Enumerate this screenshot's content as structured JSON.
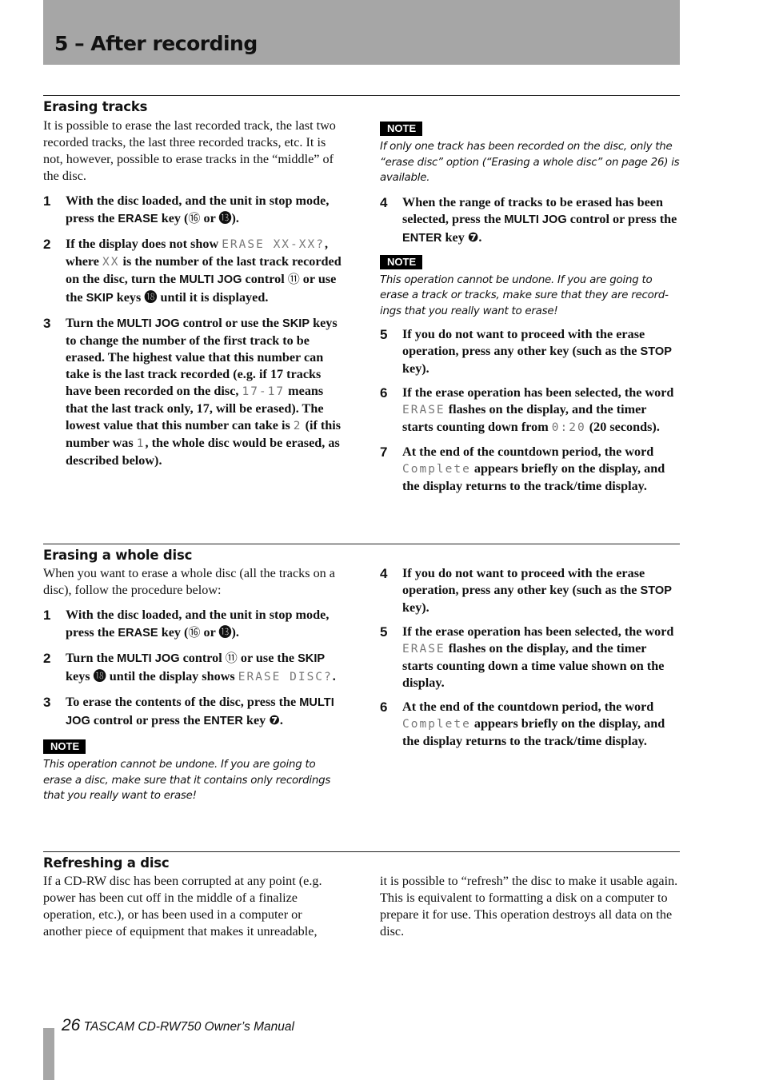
{
  "header": {
    "chapter_title": "5 – After recording"
  },
  "sections": {
    "erasing_tracks": {
      "title": "Erasing tracks",
      "intro": "It is possible to erase the last recorded track, the last two recorded tracks, the last three recorded tracks, etc. It is not, however, possible to erase tracks in the “middle” of the disc.",
      "steps_left": [
        {
          "num": "1",
          "segments": [
            {
              "t": "With the disc loaded, and the unit in stop mode, press the "
            },
            {
              "t": "ERASE",
              "s": "key"
            },
            {
              "t": " key ("
            },
            {
              "t": "⑯",
              "s": "circ"
            },
            {
              "t": " or "
            },
            {
              "t": "⓭",
              "s": "circb"
            },
            {
              "t": ")."
            }
          ]
        },
        {
          "num": "2",
          "segments": [
            {
              "t": "If the display does not show "
            },
            {
              "t": "ERASE XX-XX?",
              "s": "lcd"
            },
            {
              "t": ", where "
            },
            {
              "t": "XX",
              "s": "lcd"
            },
            {
              "t": " is the number of the last track recorded on the disc, turn the "
            },
            {
              "t": "MULTI JOG",
              "s": "key"
            },
            {
              "t": " control "
            },
            {
              "t": "⑪",
              "s": "circ"
            },
            {
              "t": " or use the "
            },
            {
              "t": "SKIP",
              "s": "key"
            },
            {
              "t": " keys "
            },
            {
              "t": "⓲",
              "s": "circb"
            },
            {
              "t": " until it is displayed."
            }
          ]
        },
        {
          "num": "3",
          "segments": [
            {
              "t": "Turn the "
            },
            {
              "t": "MULTI JOG",
              "s": "key"
            },
            {
              "t": " control or use the "
            },
            {
              "t": "SKIP",
              "s": "key"
            },
            {
              "t": " keys to change the number of the first track to be erased. The highest value that this number can take is the last track recorded (e.g. if 17 tracks have been recorded on the disc, "
            },
            {
              "t": "17-17",
              "s": "lcd"
            },
            {
              "t": " means that the last track only, 17, will be erased). The lowest value that this number can take is "
            },
            {
              "t": "2",
              "s": "lcd"
            },
            {
              "t": " (if this number was "
            },
            {
              "t": "1",
              "s": "lcd"
            },
            {
              "t": ", the whole disc would be erased, as described below)."
            }
          ]
        }
      ],
      "note1": {
        "label": "NOTE",
        "text": "If only one track has been recorded on the disc, only the “erase disc” option (“Erasing a whole disc” on page 26) is available."
      },
      "step4": {
        "num": "4",
        "segments": [
          {
            "t": "When the range of tracks to be erased has been selected, press the "
          },
          {
            "t": "MULTI JOG",
            "s": "key"
          },
          {
            "t": " control or press the "
          },
          {
            "t": "ENTER",
            "s": "key"
          },
          {
            "t": " key "
          },
          {
            "t": "❼",
            "s": "circb"
          },
          {
            "t": "."
          }
        ]
      },
      "note2": {
        "label": "NOTE",
        "text": "This operation cannot be undone. If you are going to erase a track or tracks, make sure that they are record-ings that you really want to erase!"
      },
      "steps_right": [
        {
          "num": "5",
          "segments": [
            {
              "t": "If you do not want to proceed with the erase operation, press any other key (such as the "
            },
            {
              "t": "STOP",
              "s": "key"
            },
            {
              "t": " key)."
            }
          ]
        },
        {
          "num": "6",
          "segments": [
            {
              "t": "If the erase operation has been selected, the word "
            },
            {
              "t": "ERASE",
              "s": "lcd"
            },
            {
              "t": " flashes on the display, and the timer starts counting down from "
            },
            {
              "t": "0:20",
              "s": "lcd"
            },
            {
              "t": " (20 seconds)."
            }
          ]
        },
        {
          "num": "7",
          "segments": [
            {
              "t": "At the end of the countdown period, the word "
            },
            {
              "t": "Complete",
              "s": "lcd"
            },
            {
              "t": " appears briefly on the display, and the display returns to the track/time display."
            }
          ]
        }
      ]
    },
    "erasing_whole_disc": {
      "title": "Erasing a whole disc",
      "intro": "When you want to erase a whole disc (all the tracks on a disc), follow the procedure below:",
      "steps_left": [
        {
          "num": "1",
          "segments": [
            {
              "t": "With the disc loaded, and the unit in stop mode, press the "
            },
            {
              "t": "ERASE",
              "s": "key"
            },
            {
              "t": " key ("
            },
            {
              "t": "⑯",
              "s": "circ"
            },
            {
              "t": " or "
            },
            {
              "t": "⓭",
              "s": "circb"
            },
            {
              "t": ")."
            }
          ]
        },
        {
          "num": "2",
          "segments": [
            {
              "t": "Turn the "
            },
            {
              "t": "MULTI JOG",
              "s": "key"
            },
            {
              "t": " control "
            },
            {
              "t": "⑪",
              "s": "circ"
            },
            {
              "t": " or use the "
            },
            {
              "t": "SKIP",
              "s": "key"
            },
            {
              "t": " keys "
            },
            {
              "t": "⓲",
              "s": "circb"
            },
            {
              "t": " until the display shows "
            },
            {
              "t": "ERASE DISC?",
              "s": "lcd"
            },
            {
              "t": "."
            }
          ]
        },
        {
          "num": "3",
          "segments": [
            {
              "t": "To erase the contents of the disc, press the "
            },
            {
              "t": "MULTI JOG",
              "s": "key"
            },
            {
              "t": " control or press the "
            },
            {
              "t": "ENTER",
              "s": "key"
            },
            {
              "t": " key "
            },
            {
              "t": "❼",
              "s": "circb"
            },
            {
              "t": "."
            }
          ]
        }
      ],
      "note": {
        "label": "NOTE",
        "text": "This operation cannot be undone. If you are going to erase a disc, make sure that it contains only recordings that you really want to erase!"
      },
      "steps_right": [
        {
          "num": "4",
          "segments": [
            {
              "t": "If you do not want to proceed with the erase operation, press any other key (such as the "
            },
            {
              "t": "STOP",
              "s": "key"
            },
            {
              "t": " key)."
            }
          ]
        },
        {
          "num": "5",
          "segments": [
            {
              "t": "If the erase operation has been selected, the word "
            },
            {
              "t": "ERASE",
              "s": "lcd"
            },
            {
              "t": " flashes on the display, and the timer starts counting down a time value shown on the display."
            }
          ]
        },
        {
          "num": "6",
          "segments": [
            {
              "t": "At the end of the countdown period, the word "
            },
            {
              "t": "Complete",
              "s": "lcd"
            },
            {
              "t": " appears briefly on the display, and the display returns to the track/time display."
            }
          ]
        }
      ]
    },
    "refreshing_disc": {
      "title": "Refreshing a disc",
      "text_left": "If a CD-RW disc has been corrupted at any point (e.g. power has been cut off in the middle of a finalize operation, etc.), or has been used in a computer or another piece of equipment that makes it unreadable,",
      "text_right": "it is possible to “refresh” the disc to make it usable again. This is equivalent to formatting a disk on a computer to prepare it for use. This operation destroys all data on the disc."
    }
  },
  "footer": {
    "page_number": "26",
    "manual_title": "TASCAM CD-RW750 Owner’s Manual"
  }
}
